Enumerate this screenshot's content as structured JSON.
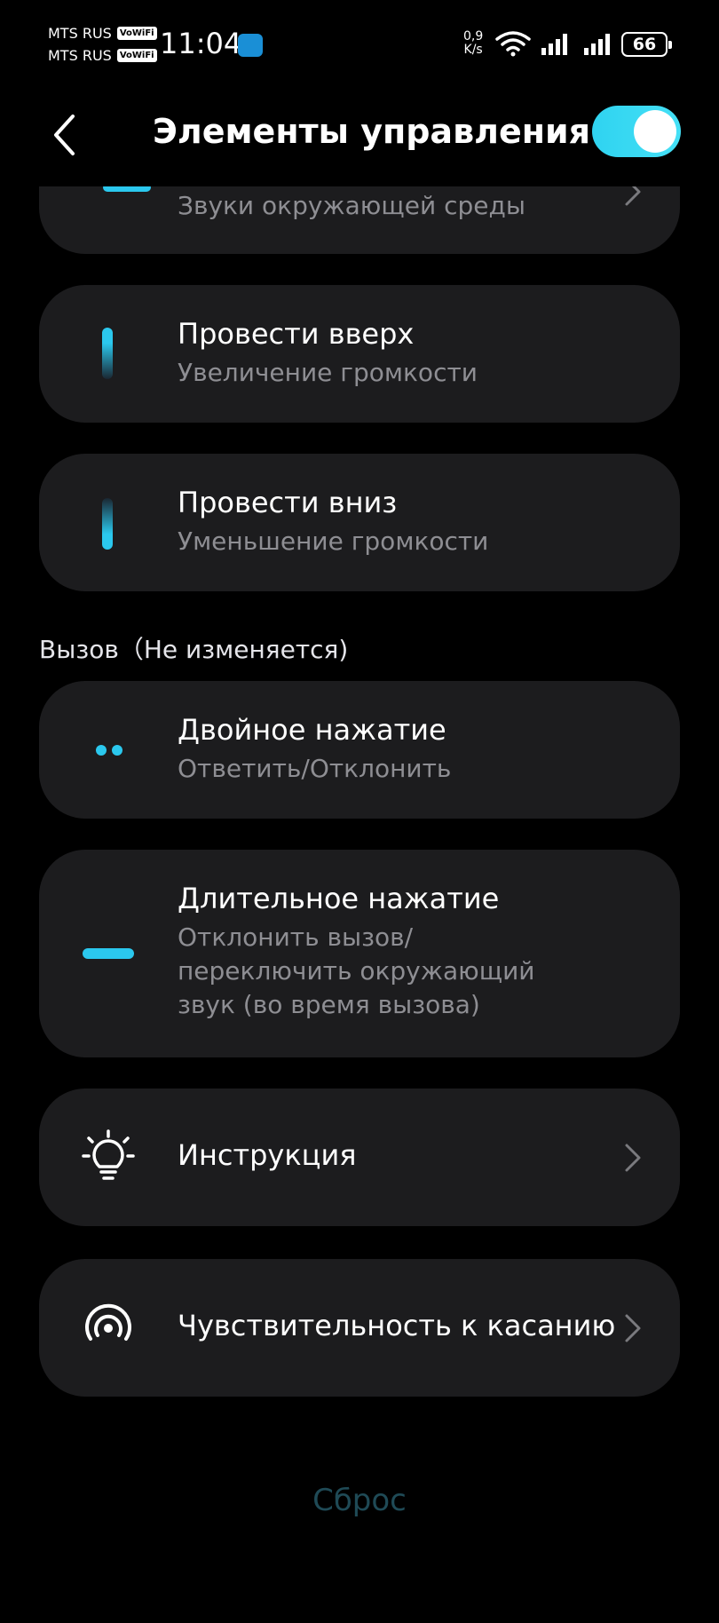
{
  "status_bar": {
    "carrier1": "MTS RUS",
    "carrier2": "MTS RUS",
    "vowifi": "VoWiFi",
    "time": "11:04",
    "net_speed_value": "0,9",
    "net_speed_unit": "K/s",
    "battery": "66"
  },
  "header": {
    "title": "Элементы управления",
    "toggle_on": true
  },
  "cards": {
    "ambient": {
      "subtitle": "Звуки окружающей среды"
    },
    "swipe_up": {
      "title": "Провести вверх",
      "subtitle": "Увеличение громкости"
    },
    "swipe_down": {
      "title": "Провести вниз",
      "subtitle": "Уменьшение громкости"
    },
    "double_tap": {
      "title": "Двойное нажатие",
      "subtitle": "Ответить/Отклонить"
    },
    "long_press": {
      "title": "Длительное нажатие",
      "subtitle_line1": "Отклонить вызов/",
      "subtitle_line2": "переключить окружающий",
      "subtitle_line3": "звук (во время вызова)"
    },
    "instructions": {
      "title": "Инструкция"
    },
    "sensitivity": {
      "title": "Чувствительность к касанию"
    }
  },
  "section": {
    "call_label": "Вызов（Не изменяется)"
  },
  "footer": {
    "reset_label": "Сброс"
  },
  "colors": {
    "accent": "#2bc8ee",
    "card_bg": "#1c1c1e",
    "subtitle": "#8e8e93",
    "reset": "#1f4a56"
  },
  "icons": {
    "back": "chevron-left-icon",
    "chevron": "chevron-right-icon",
    "bulb": "lightbulb-icon",
    "touch": "touch-sensitivity-icon",
    "wifi": "wifi-icon",
    "signal": "signal-icon"
  }
}
